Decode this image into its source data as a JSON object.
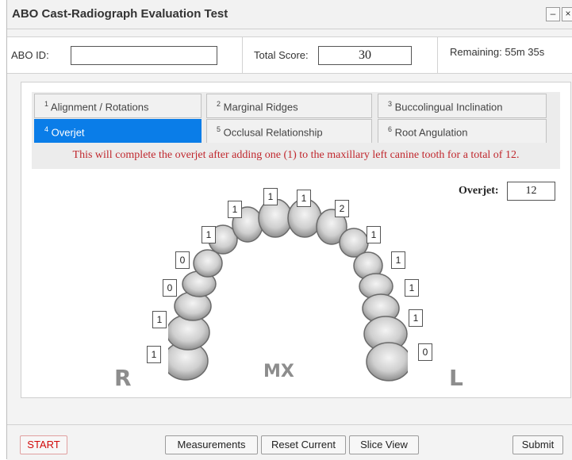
{
  "window": {
    "title": "ABO Cast-Radiograph Evaluation Test",
    "min_label": "–",
    "close_label": "×"
  },
  "info": {
    "abo_id_label": "ABO ID:",
    "abo_id_value": "",
    "total_score_label": "Total Score:",
    "total_score_value": "30",
    "remaining": "Remaining: 55m 35s"
  },
  "tabs": [
    {
      "num": "1",
      "label": "Alignment / Rotations"
    },
    {
      "num": "2",
      "label": "Marginal Ridges"
    },
    {
      "num": "3",
      "label": "Buccolingual Inclination"
    },
    {
      "num": "4",
      "label": "Overjet"
    },
    {
      "num": "5",
      "label": "Occlusal Relationship"
    },
    {
      "num": "6",
      "label": "Root Angulation"
    }
  ],
  "message": "This will complete the overjet after adding one (1) to the maxillary left canine tooth for a total of 12.",
  "overjet": {
    "label": "Overjet:",
    "value": "12"
  },
  "teeth_scores": {
    "r1": "1",
    "r2": "1",
    "r3": "0",
    "r4": "0",
    "r5": "1",
    "r6": "1",
    "r7": "1",
    "l1": "1",
    "l2": "2",
    "l3": "1",
    "l4": "1",
    "l5": "1",
    "l6": "1",
    "l7": "0"
  },
  "arch_labels": {
    "right": "R",
    "center": "MX",
    "left": "L"
  },
  "buttons": {
    "start": "START",
    "measurements": "Measurements",
    "reset": "Reset Current",
    "slice": "Slice View",
    "submit": "Submit"
  }
}
